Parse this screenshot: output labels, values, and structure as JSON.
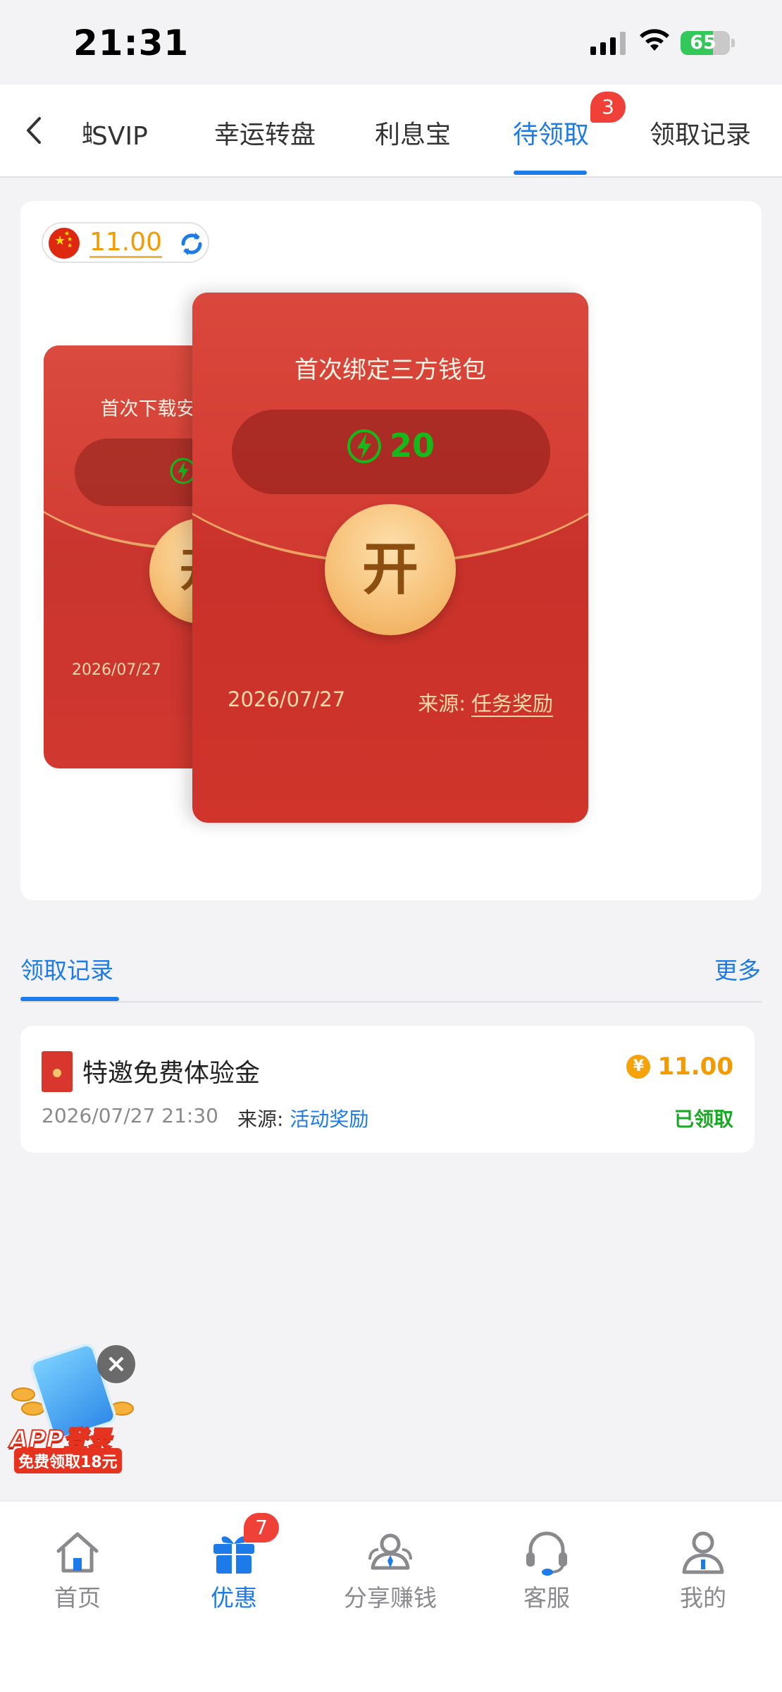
{
  "status_bar": {
    "time": "21:31",
    "battery": "65"
  },
  "tabs": [
    {
      "label": "SVIP",
      "active": false
    },
    {
      "label": "幸运转盘",
      "active": false
    },
    {
      "label": "利息宝",
      "active": false
    },
    {
      "label": "待领取",
      "active": true,
      "badge": "3"
    },
    {
      "label": "领取记录",
      "active": false
    }
  ],
  "balance": {
    "amount": "11.00"
  },
  "envelopes": [
    {
      "title": "首次下载安",
      "date": "2026/07/27",
      "open_label": "开"
    },
    {
      "title": "首次绑定三方钱包",
      "amount": "20",
      "open_label": "开",
      "date": "2026/07/27",
      "source_label": "来源:",
      "source_value": "任务奖励"
    }
  ],
  "records": {
    "tab_label": "领取记录",
    "more_label": "更多",
    "items": [
      {
        "title": "特邀免费体验金",
        "coin_symbol": "¥",
        "amount": "11.00",
        "datetime": "2026/07/27 21:30",
        "source_label": "来源:",
        "source_value": "活动奖励",
        "status": "已领取"
      }
    ]
  },
  "promo": {
    "line1": "APP登录",
    "line2": "免费领取18元",
    "close": "×"
  },
  "bottom_nav": [
    {
      "label": "首页",
      "icon": "home-icon",
      "active": false
    },
    {
      "label": "优惠",
      "icon": "gift-icon",
      "active": true,
      "badge": "7"
    },
    {
      "label": "分享赚钱",
      "icon": "share-users-icon",
      "active": false
    },
    {
      "label": "客服",
      "icon": "headset-icon",
      "active": false
    },
    {
      "label": "我的",
      "icon": "profile-icon",
      "active": false
    }
  ],
  "colors": {
    "accent": "#1c7be8",
    "envelope_red": "#d0342b",
    "gold": "#f29a00",
    "success": "#19a924",
    "badge_red": "#ef4138"
  }
}
